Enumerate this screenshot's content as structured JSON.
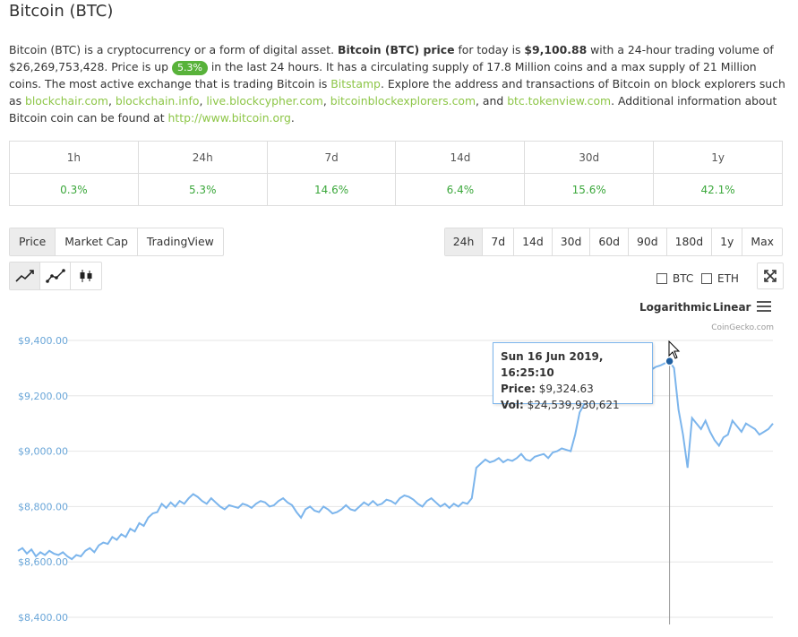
{
  "page": {
    "title": "Bitcoin (BTC)"
  },
  "description": {
    "p1": "Bitcoin (BTC) is a cryptocurrency or a form of digital asset. ",
    "p2": "Bitcoin (BTC) price",
    "p3": " for today is ",
    "price": "$9,100.88",
    "p4": " with a 24-hour trading volume of $26,269,753,428. Price is up ",
    "change_badge": "5.3%",
    "p5": " in the last 24 hours. It has a circulating supply of 17.8 Million coins and a max supply of 21 Million coins. The most active exchange that is trading Bitcoin is ",
    "exchange_link": "Bitstamp",
    "p6": ". Explore the address and transactions of Bitcoin on block explorers such as ",
    "explorer1": "blockchair.com",
    "sep1": ", ",
    "explorer2": "blockchain.info",
    "sep2": ", ",
    "explorer3": "live.blockcypher.com",
    "sep3": ", ",
    "explorer4": "bitcoinblockexplorers.com",
    "sep4": ", and ",
    "explorer5": "btc.tokenview.com",
    "p7": ". Additional information about Bitcoin coin can be found at ",
    "site_link": "http://www.bitcoin.org",
    "p8": "."
  },
  "performance": {
    "headers": [
      "1h",
      "24h",
      "7d",
      "14d",
      "30d",
      "1y"
    ],
    "values": [
      "0.3%",
      "5.3%",
      "14.6%",
      "6.4%",
      "15.6%",
      "42.1%"
    ]
  },
  "tabs": [
    "Price",
    "Market Cap",
    "TradingView"
  ],
  "active_tab": "Price",
  "ranges": [
    "24h",
    "7d",
    "14d",
    "30d",
    "60d",
    "90d",
    "180d",
    "1y",
    "Max"
  ],
  "active_range": "24h",
  "chart_type_icons": [
    "line-chart-icon",
    "line-points-icon",
    "candlestick-icon"
  ],
  "compare": {
    "btc": "BTC",
    "eth": "ETH"
  },
  "scale": {
    "log": "Logarithmic",
    "linear": "Linear"
  },
  "credit": "CoinGecko.com",
  "tooltip": {
    "date": "Sun 16 Jun 2019, 16:25:10",
    "price_label": "Price:",
    "price_value": "$9,324.63",
    "vol_label": "Vol:",
    "vol_value": "$24,539,930,621"
  },
  "colors": {
    "accent": "#8dc647",
    "positive": "#3ca83c",
    "line": "#7cb5ec",
    "badge": "#58b23a"
  },
  "chart_data": {
    "type": "line",
    "title": "",
    "xlabel": "",
    "ylabel": "",
    "ylim": [
      8400,
      9400
    ],
    "yticks": [
      "$9,400.00",
      "$9,200.00",
      "$9,000.00",
      "$8,800.00",
      "$8,600.00",
      "$8,400.00"
    ],
    "ytick_values": [
      9400,
      9200,
      9000,
      8800,
      8600,
      8400
    ],
    "grid": true,
    "series": [
      {
        "values": [
          8640,
          8650,
          8630,
          8645,
          8620,
          8635,
          8625,
          8640,
          8630,
          8625,
          8635,
          8620,
          8610,
          8625,
          8620,
          8640,
          8650,
          8635,
          8660,
          8670,
          8665,
          8690,
          8680,
          8700,
          8690,
          8720,
          8710,
          8740,
          8730,
          8760,
          8775,
          8780,
          8810,
          8795,
          8815,
          8800,
          8820,
          8810,
          8830,
          8845,
          8835,
          8820,
          8810,
          8830,
          8815,
          8800,
          8790,
          8805,
          8800,
          8795,
          8810,
          8805,
          8795,
          8810,
          8820,
          8815,
          8800,
          8805,
          8820,
          8830,
          8815,
          8805,
          8780,
          8760,
          8790,
          8800,
          8785,
          8780,
          8800,
          8790,
          8775,
          8780,
          8790,
          8805,
          8790,
          8785,
          8800,
          8815,
          8805,
          8820,
          8805,
          8810,
          8825,
          8820,
          8810,
          8830,
          8840,
          8835,
          8825,
          8810,
          8800,
          8820,
          8830,
          8815,
          8800,
          8810,
          8795,
          8810,
          8800,
          8815,
          8810,
          8830,
          8940,
          8955,
          8970,
          8960,
          8965,
          8975,
          8960,
          8970,
          8965,
          8975,
          8990,
          8970,
          8965,
          8980,
          8985,
          8990,
          8975,
          8995,
          9000,
          9010,
          9005,
          9000,
          9060,
          9140,
          9170,
          9200,
          9180,
          9185,
          9210,
          9230,
          9225,
          9240,
          9255,
          9245,
          9260,
          9270,
          9290,
          9300,
          9290,
          9295,
          9305,
          9310,
          9318,
          9325,
          9300,
          9150,
          9060,
          8940,
          9120,
          9100,
          9080,
          9110,
          9070,
          9040,
          9020,
          9050,
          9060,
          9110,
          9090,
          9070,
          9100,
          9090,
          9080,
          9060,
          9070,
          9080,
          9100
        ]
      }
    ],
    "highlight": {
      "price": 9324.63
    }
  }
}
